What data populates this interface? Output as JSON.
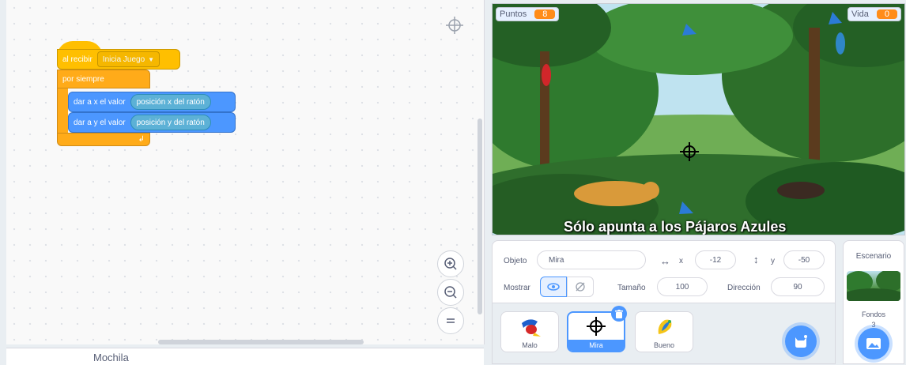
{
  "code": {
    "hat_label": "al recibir",
    "hat_message": "Inicia Juego",
    "forever_label": "por siempre",
    "set_x_label": "dar a x el valor",
    "set_x_reporter": "posición x del ratón",
    "set_y_label": "dar a y el valor",
    "set_y_reporter": "posición y del ratón",
    "backpack_label": "Mochila",
    "icons": [
      "crosshair-icon",
      "zoom-in-icon",
      "zoom-out-icon",
      "zoom-reset-icon"
    ]
  },
  "stage": {
    "score_label": "Puntos",
    "score_value": "8",
    "life_label": "Vida",
    "life_value": "0",
    "caption": "Sólo apunta a los Pájaros Azules"
  },
  "sprite_info": {
    "sprite_label": "Objeto",
    "sprite_name": "Mira",
    "x_label": "x",
    "x_value": "-12",
    "y_label": "y",
    "y_value": "-50",
    "show_label": "Mostrar",
    "size_label": "Tamaño",
    "size_value": "100",
    "direction_label": "Dirección",
    "direction_value": "90"
  },
  "sprites": [
    {
      "name": "Malo"
    },
    {
      "name": "Mira"
    },
    {
      "name": "Bueno"
    }
  ],
  "stage_panel": {
    "title": "Escenario",
    "backdrops_label": "Fondos",
    "backdrops_count": "3"
  },
  "colors": {
    "events": "#ffbf00",
    "control": "#ffab19",
    "motion": "#4c97ff",
    "sensing": "#5cb1d6",
    "monitor_value": "#ff8c1a"
  }
}
